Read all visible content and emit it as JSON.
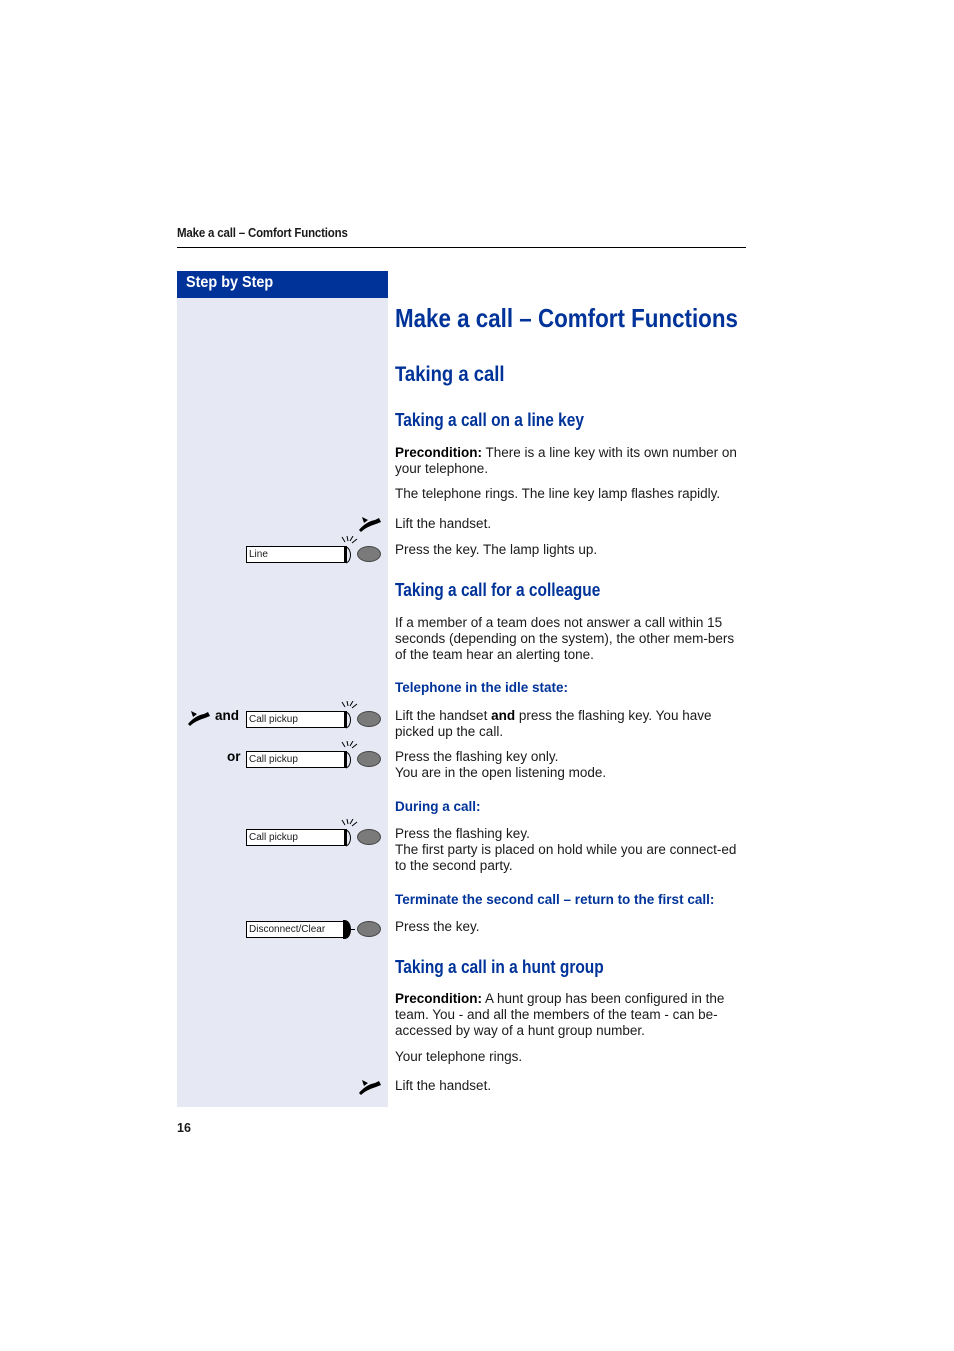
{
  "running_header": "Make a call – Comfort Functions",
  "sidebar_title": "Step by Step",
  "page_number": "16",
  "title": "Make a call – Comfort Functions",
  "section": "Taking a call",
  "line_key": {
    "heading": "Taking a call on a line key",
    "precondition_label": "Precondition:",
    "precondition_text": " There is a line key with its own number on your telephone.",
    "ring_text": "The telephone rings. The line key lamp flashes rapidly.",
    "step1": "Lift the handset.",
    "step2": "Press the key. The lamp lights up.",
    "key_label": "Line"
  },
  "colleague": {
    "heading": "Taking a call for a colleague",
    "intro": "If a member of a team does not answer a call within 15 seconds (depending on the system), the other mem-bers of the team hear an alerting tone.",
    "idle_heading": "Telephone in the idle state:",
    "and_label": "and",
    "or_label": "or",
    "key_label": "Call pickup",
    "idle_step1_a": "Lift the handset ",
    "idle_step1_bold": "and",
    "idle_step1_b": " press the flashing key. You have picked up the call.",
    "idle_step2_line1": "Press the flashing key only.",
    "idle_step2_line2": "You are in the open listening mode.",
    "during_heading": "During a call:",
    "during_line1": "Press the flashing key.",
    "during_line2": "The first party is placed on hold while you are connect-ed to the second party.",
    "terminate_heading": "Terminate the second call – return to the first call:",
    "terminate_key_label": "Disconnect/Clear",
    "terminate_step": "Press the key."
  },
  "hunt_group": {
    "heading": "Taking a call in a hunt group",
    "precondition_label": "Precondition:",
    "precondition_text": " A hunt group has been configured in the team. You - and all the members of the team - can be-accessed by way of a hunt group number.",
    "ring_text": "Your telephone rings.",
    "step": "Lift the handset."
  }
}
